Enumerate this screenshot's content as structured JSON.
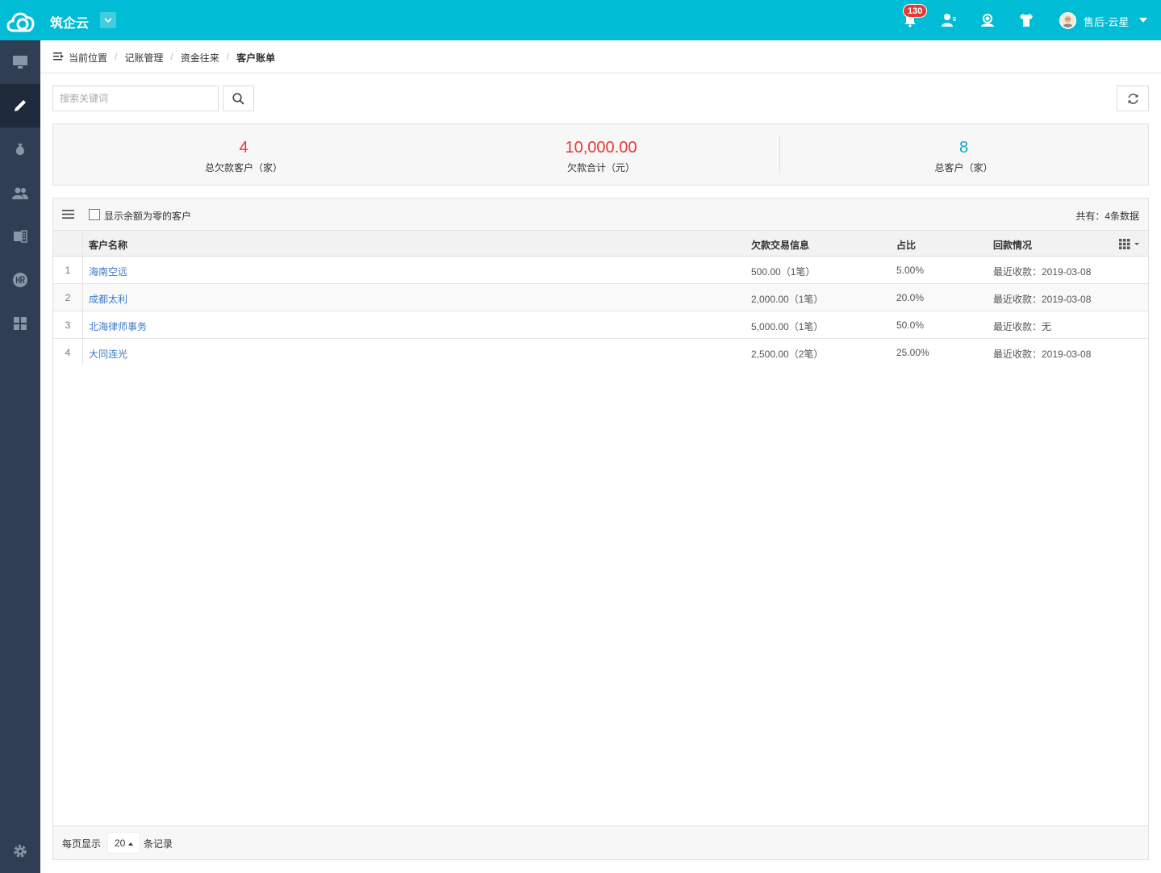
{
  "header": {
    "app_title": "筑企云",
    "notification_count": "130",
    "user_name": "售后-云星"
  },
  "sidebar": {
    "items": [
      {
        "icon": "monitor-icon",
        "active": false
      },
      {
        "icon": "pencil-icon",
        "active": true
      },
      {
        "icon": "money-bag-icon",
        "active": false
      },
      {
        "icon": "users-icon",
        "active": false
      },
      {
        "icon": "office-icon",
        "active": false
      },
      {
        "icon": "hr-icon",
        "active": false
      },
      {
        "icon": "grid-icon",
        "active": false
      }
    ],
    "bottom_icon": "gear-icon"
  },
  "breadcrumb": {
    "prefix": "当前位置",
    "items": [
      "记账管理",
      "资金往来"
    ],
    "current": "客户账单"
  },
  "search": {
    "placeholder": "搜索关键词",
    "value": ""
  },
  "stats": [
    {
      "value": "4",
      "label": "总欠款客户（家）",
      "color": "#e53935"
    },
    {
      "value": "10,000.00",
      "label": "欠款合计（元）",
      "color": "#e53935"
    },
    {
      "value": "8",
      "label": "总客户（家）",
      "color": "#00a8d4"
    }
  ],
  "table": {
    "show_zero_label": "显示余额为零的客户",
    "total_label": "共有：4条数据",
    "columns": [
      "客户名称",
      "欠款交易信息",
      "占比",
      "回款情况"
    ],
    "rows": [
      {
        "num": "1",
        "name": "海南空远",
        "info": "500.00（1笔）",
        "ratio": "5.00%",
        "status": "最近收款：2019-03-08"
      },
      {
        "num": "2",
        "name": "成都太利",
        "info": "2,000.00（1笔）",
        "ratio": "20.0%",
        "status": "最近收款：2019-03-08"
      },
      {
        "num": "3",
        "name": "北海律师事务",
        "info": "5,000.00（1笔）",
        "ratio": "50.0%",
        "status": "最近收款：无"
      },
      {
        "num": "4",
        "name": "大同连光",
        "info": "2,500.00（2笔）",
        "ratio": "25.00%",
        "status": "最近收款：2019-03-08"
      }
    ]
  },
  "footer": {
    "per_page_label": "每页显示",
    "per_page_value": "20",
    "records_label": "条记录"
  }
}
